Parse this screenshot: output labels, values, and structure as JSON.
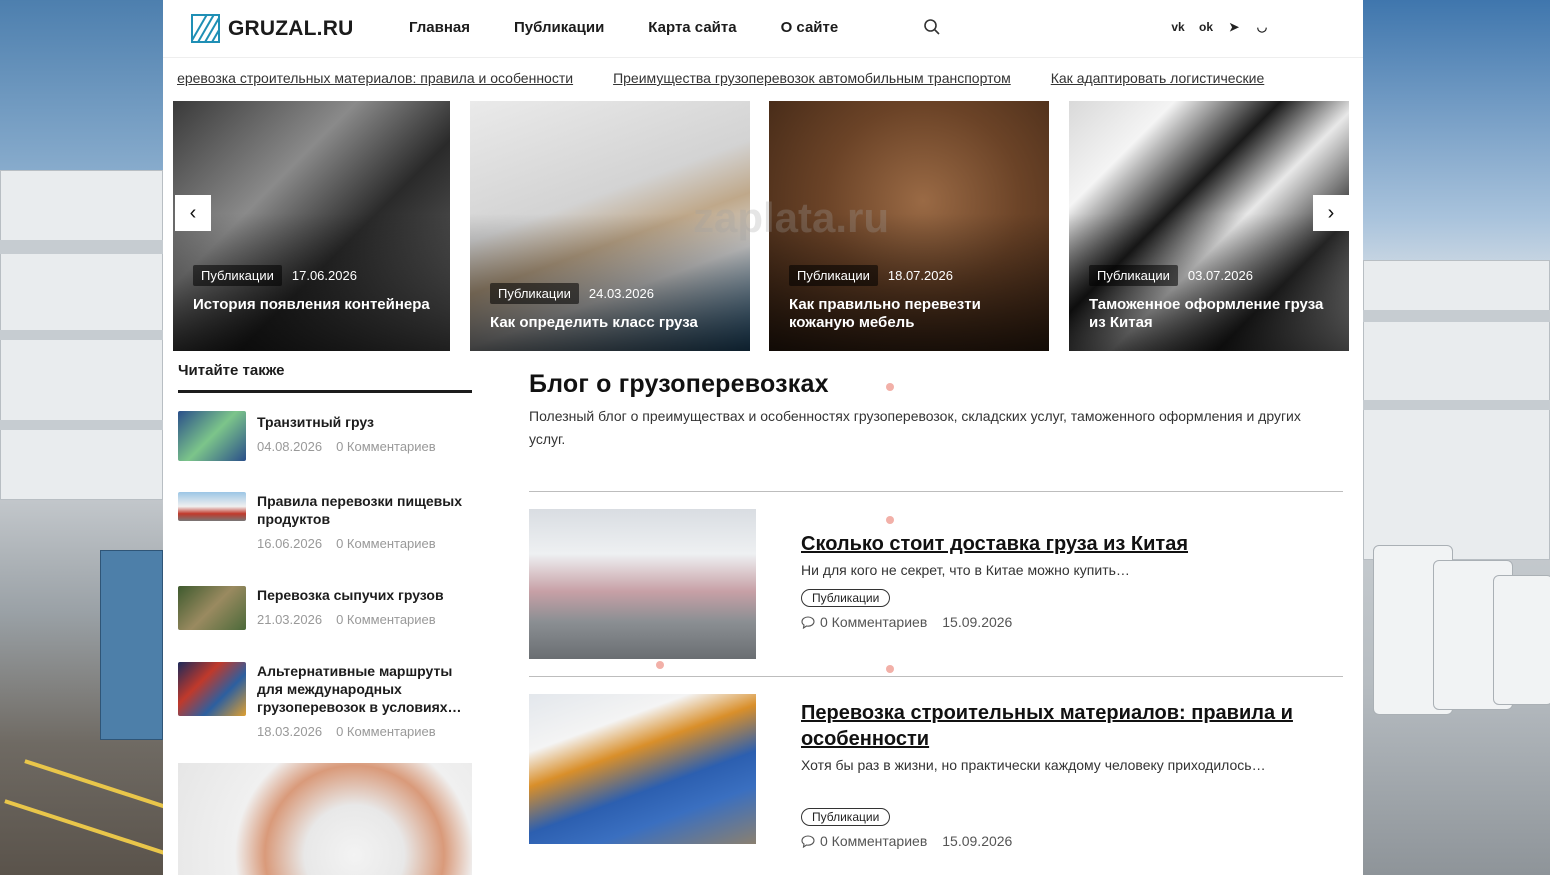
{
  "header": {
    "logo_text": "GRUZAL.RU",
    "nav": [
      "Главная",
      "Публикации",
      "Карта сайта",
      "О сайте"
    ],
    "social": [
      "vk-icon",
      "odnoklassniki-icon",
      "telegram-icon",
      "mail-icon"
    ],
    "social_glyphs": [
      "vk",
      "ok",
      "➤",
      "◡"
    ]
  },
  "ticker": [
    "Перевозка строительных материалов: правила и особенности",
    "Преимущества грузоперевозок автомобильным транспортом",
    "Как адаптировать логистические"
  ],
  "slider": [
    {
      "category": "Публикации",
      "date": "17.06.2026",
      "title": "История появления контейнера"
    },
    {
      "category": "Публикации",
      "date": "24.03.2026",
      "title": "Как определить класс груза"
    },
    {
      "category": "Публикации",
      "date": "18.07.2026",
      "title": "Как правильно перевезти кожаную мебель"
    },
    {
      "category": "Публикации",
      "date": "03.07.2026",
      "title": "Таможенное оформление груза из Китая"
    }
  ],
  "sidebar": {
    "title": "Читайте также",
    "items": [
      {
        "title": "Транзитный груз",
        "date": "04.08.2026",
        "comments": "0 Комментариев"
      },
      {
        "title": "Правила перевозки пищевых продуктов",
        "date": "16.06.2026",
        "comments": "0 Комментариев"
      },
      {
        "title": "Перевозка сыпучих грузов",
        "date": "21.03.2026",
        "comments": "0 Комментариев"
      },
      {
        "title": "Альтернативные маршруты для международных грузоперевозок в условиях…",
        "date": "18.03.2026",
        "comments": "0 Комментариев"
      }
    ]
  },
  "main": {
    "title": "Блог о грузоперевозках",
    "description": "Полезный блог о преимуществах и особенностях грузоперевозок, складских услуг, таможенного оформления и других услуг.",
    "posts": [
      {
        "title": "Сколько стоит доставка груза из Китая",
        "excerpt": "Ни для кого не секрет, что в Китае можно купить…",
        "tag": "Публикации",
        "comments": "0 Комментариев",
        "date": "15.09.2026"
      },
      {
        "title": "Перевозка строительных материалов: правила и особенности",
        "excerpt": "Хотя бы раз в жизни, но практически каждому человеку приходилось…",
        "tag": "Публикации",
        "comments": "0 Комментариев",
        "date": "15.09.2026"
      }
    ]
  },
  "watermark": "zaplata.ru"
}
